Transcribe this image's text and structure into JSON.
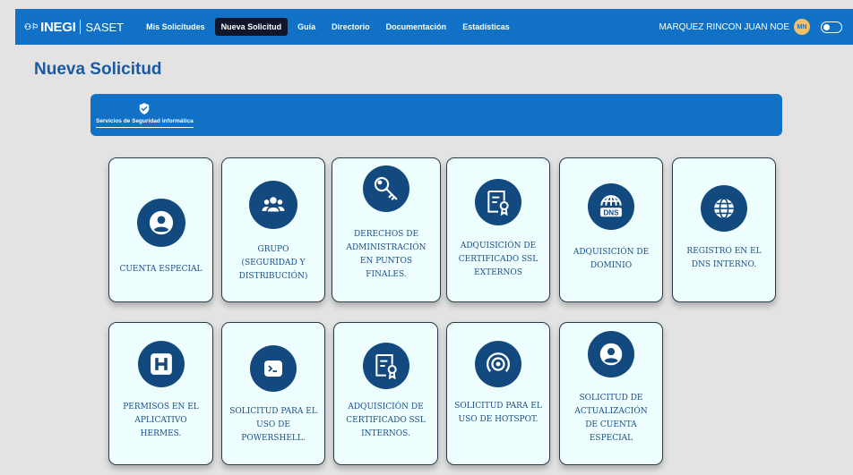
{
  "header": {
    "logo_mark": "⚇⚐",
    "logo_text": "INEGI",
    "app_name": "SASET",
    "nav": [
      "Mis Solicitudes",
      "Nueva Solicitud",
      "Guía",
      "Directorio",
      "Documentación",
      "Estadísticas"
    ],
    "active_nav": "Nueva Solicitud",
    "user_name": "MARQUEZ RINCON JUAN NOE",
    "user_initials": "MN"
  },
  "page": {
    "title": "Nueva Solicitud"
  },
  "service_tab": {
    "label": "Servicios de Seguridad informática",
    "icon": "shield-check-icon"
  },
  "cards": [
    {
      "label": "CUENTA ESPECIAL",
      "icon": "user-circle-icon"
    },
    {
      "label": "GRUPO (SEGURIDAD Y DISTRIBUCIÓN)",
      "icon": "users-group-icon"
    },
    {
      "label": "DERECHOS DE ADMINISTRACIÓN EN PUNTOS FINALES.",
      "icon": "key-icon"
    },
    {
      "label": "ADQUISICIÓN DE CERTIFICADO SSL EXTERNOS",
      "icon": "certificate-icon"
    },
    {
      "label": "ADQUISICIÓN DE DOMINIO",
      "icon": "dns-globe-icon"
    },
    {
      "label": "REGISTRO EN EL DNS INTERNO.",
      "icon": "globe-icon"
    },
    {
      "label": "PERMISOS EN EL APLICATIVO HERMES.",
      "icon": "hospital-h-icon"
    },
    {
      "label": "SOLICITUD PARA EL USO DE POWERSHELL.",
      "icon": "terminal-icon"
    },
    {
      "label": "ADQUISICIÓN DE CERTIFICADO SSL INTERNOS.",
      "icon": "certificate-icon"
    },
    {
      "label": "SOLICITUD PARA EL USO DE HOTSPOT.",
      "icon": "hotspot-icon"
    },
    {
      "label": "SOLICITUD DE ACTUALIZACIÓN DE CUENTA ESPECIAL",
      "icon": "user-circle-icon"
    }
  ]
}
